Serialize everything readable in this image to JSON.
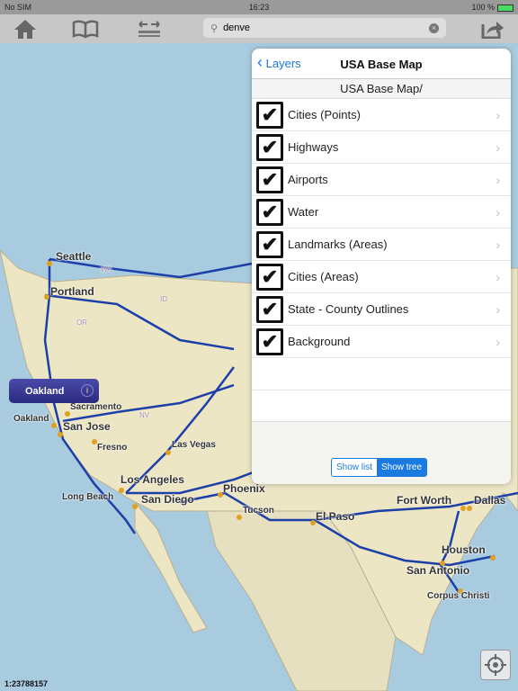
{
  "status": {
    "carrier": "No SIM",
    "time": "16:23",
    "battery": "100 %"
  },
  "toolbar": {
    "search_value": "denve",
    "icons": [
      "home-icon",
      "book-icon",
      "swap-icon",
      "share-icon"
    ]
  },
  "map": {
    "cities": [
      {
        "name": "Seattle",
        "big": true
      },
      {
        "name": "Portland",
        "big": true
      },
      {
        "name": "Sacramento",
        "big": false
      },
      {
        "name": "Oakland",
        "big": false
      },
      {
        "name": "San Jose",
        "big": true
      },
      {
        "name": "Fresno",
        "big": false
      },
      {
        "name": "Las Vegas",
        "big": false
      },
      {
        "name": "Los Angeles",
        "big": true
      },
      {
        "name": "Long Beach",
        "big": false
      },
      {
        "name": "San Diego",
        "big": true
      },
      {
        "name": "Phoenix",
        "big": true
      },
      {
        "name": "Tucson",
        "big": false
      },
      {
        "name": "El Paso",
        "big": true
      },
      {
        "name": "Fort Worth",
        "big": true
      },
      {
        "name": "Dallas",
        "big": true
      },
      {
        "name": "Houston",
        "big": true
      },
      {
        "name": "San Antonio",
        "big": true
      },
      {
        "name": "Corpus Christi",
        "big": false
      }
    ],
    "states": [
      "WA",
      "ID",
      "OR",
      "NV"
    ],
    "callout": "Oakland",
    "scale": "1:23788157",
    "colors": {
      "water": "#a9cbe0",
      "land": "#ece6c4",
      "roads": "#1c3fa8",
      "city": "#e0a020"
    }
  },
  "panel": {
    "back_label": "Layers",
    "title": "USA Base Map",
    "path": "USA Base Map/",
    "layers": [
      {
        "label": "Cities (Points)",
        "checked": true
      },
      {
        "label": "Highways",
        "checked": true
      },
      {
        "label": "Airports",
        "checked": true
      },
      {
        "label": "Water",
        "checked": true
      },
      {
        "label": "Landmarks (Areas)",
        "checked": true
      },
      {
        "label": "Cities (Areas)",
        "checked": true
      },
      {
        "label": "State - County Outlines",
        "checked": true
      },
      {
        "label": "Background",
        "checked": true
      }
    ],
    "show_list": "Show list",
    "show_tree": "Show tree",
    "selected_view": "Show tree"
  }
}
